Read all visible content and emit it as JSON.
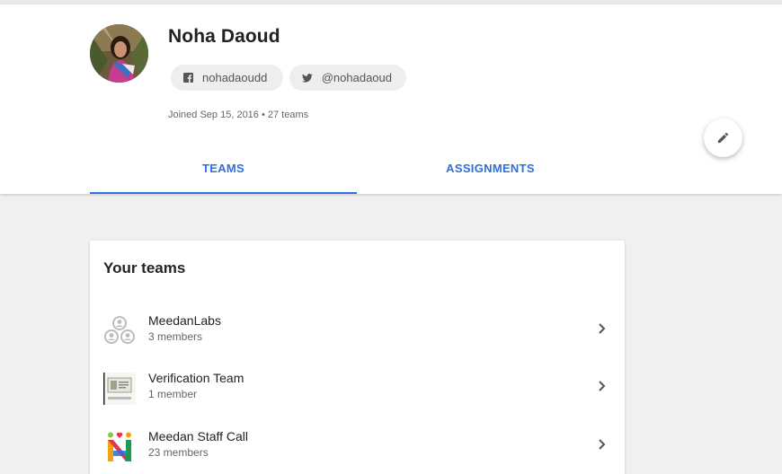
{
  "profile": {
    "name": "Noha Daoud",
    "facebook": "nohadaoudd",
    "twitter": "@nohadaoud",
    "meta": "Joined Sep 15, 2016 • 27 teams"
  },
  "tabs": [
    {
      "label": "TEAMS",
      "active": true
    },
    {
      "label": "ASSIGNMENTS",
      "active": false
    }
  ],
  "teams_card": {
    "title": "Your teams",
    "teams": [
      {
        "name": "MeedanLabs",
        "members": "3 members",
        "icon": "group-icon"
      },
      {
        "name": "Verification Team",
        "members": "1 member",
        "icon": "verification-logo-icon"
      },
      {
        "name": "Meedan Staff Call",
        "members": "23 members",
        "icon": "meedan-logo-icon"
      }
    ]
  },
  "colors": {
    "accent": "#2f6fde",
    "background": "#f0f0f0"
  },
  "icons": [
    "facebook-icon",
    "twitter-icon",
    "pencil-icon",
    "chevron-right-icon"
  ]
}
